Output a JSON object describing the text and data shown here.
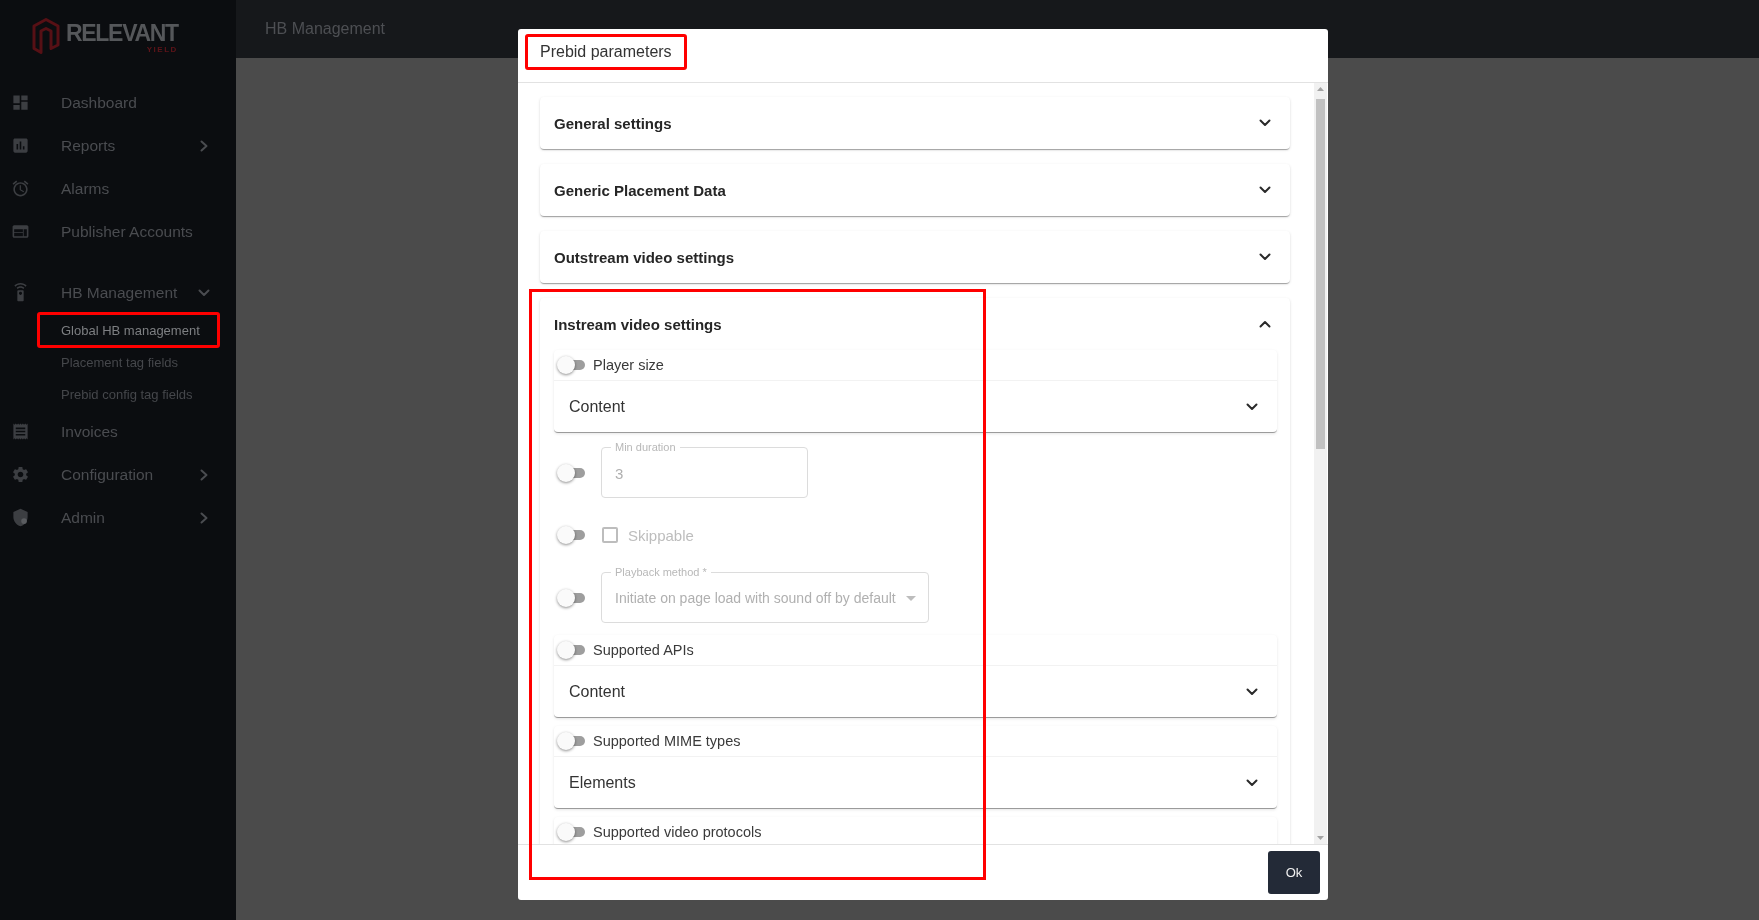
{
  "sidebar": {
    "logo": {
      "wordmark": "RELEVANT",
      "tagline": "YIELD"
    },
    "items": [
      {
        "kind": "link",
        "label": "Dashboard",
        "selected": false
      },
      {
        "kind": "group",
        "label": "Reports",
        "selected": false,
        "expanded": false
      },
      {
        "kind": "link",
        "label": "Alarms",
        "selected": false
      },
      {
        "kind": "link",
        "label": "Publisher Accounts",
        "selected": false
      },
      {
        "kind": "group",
        "label": "HB Management",
        "selected": false,
        "expanded": true,
        "children": [
          {
            "label": "Global HB management",
            "selected": true,
            "highlighted": true
          },
          {
            "label": "Placement tag fields",
            "selected": false,
            "highlighted": false
          },
          {
            "label": "Prebid config tag fields",
            "selected": false,
            "highlighted": false
          }
        ]
      },
      {
        "kind": "link",
        "label": "Invoices",
        "selected": false
      },
      {
        "kind": "group",
        "label": "Configuration",
        "selected": false,
        "expanded": false
      },
      {
        "kind": "group",
        "label": "Admin",
        "selected": false,
        "expanded": false
      }
    ]
  },
  "topbar": {
    "title": "HB Management"
  },
  "dialog": {
    "title": "Prebid parameters",
    "title_highlighted": true,
    "sections": [
      {
        "title": "General settings",
        "expanded": false,
        "highlighted": false
      },
      {
        "title": "Generic Placement Data",
        "expanded": false,
        "highlighted": false
      },
      {
        "title": "Outstream video settings",
        "expanded": false,
        "highlighted": false
      },
      {
        "title": "Instream video settings",
        "expanded": true,
        "highlighted": true,
        "fields": [
          {
            "kind": "select_card",
            "label": "Player size",
            "on": false,
            "disabled": false,
            "value": "Content"
          },
          {
            "kind": "text_input",
            "label": "Min duration",
            "on": false,
            "disabled": true,
            "value": "3"
          },
          {
            "kind": "checkbox",
            "label": "Skippable",
            "on": false,
            "disabled": true,
            "checked": false
          },
          {
            "kind": "select_input",
            "label": "Playback method *",
            "on": false,
            "disabled": true,
            "value": "Initiate on page load with sound off by default"
          },
          {
            "kind": "select_card",
            "label": "Supported APIs",
            "on": false,
            "disabled": false,
            "value": "Content"
          },
          {
            "kind": "select_card",
            "label": "Supported MIME types",
            "on": false,
            "disabled": false,
            "value": "Elements"
          },
          {
            "kind": "select_card",
            "label": "Supported video protocols",
            "on": false,
            "disabled": false
          }
        ]
      }
    ],
    "buttons": [
      {
        "label": "Ok"
      }
    ]
  }
}
